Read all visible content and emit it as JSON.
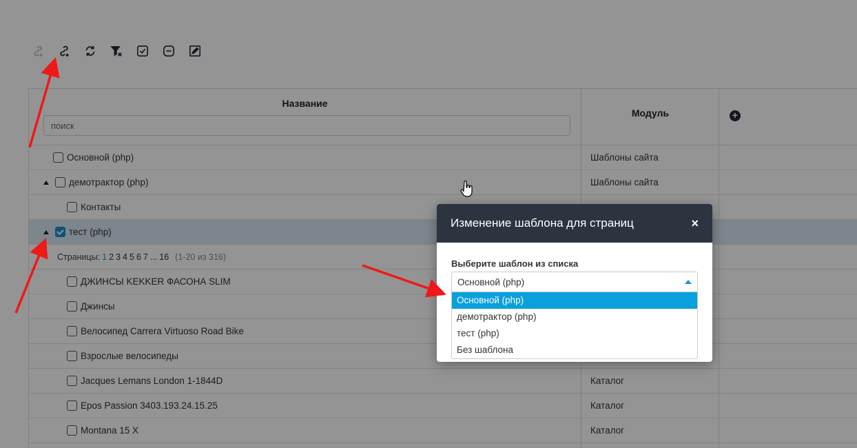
{
  "toolbar": {
    "icons": [
      "link-add-disabled-icon",
      "link-add-icon",
      "refresh-icon",
      "filter-clear-icon",
      "check-all-icon",
      "uncheck-all-icon",
      "edit-icon"
    ]
  },
  "table": {
    "col_title": "Название",
    "col_module": "Модуль",
    "search_placeholder": "поиск",
    "rows": [
      {
        "name": "Основной (php)",
        "module": "Шаблоны сайта"
      },
      {
        "name": "демотрактор (php)",
        "module": "Шаблоны сайта"
      },
      {
        "name": "Контакты",
        "module": ""
      },
      {
        "name": "тест (php)",
        "module": ""
      },
      {
        "name": "ДЖИНСЫ KEKKER ФАСОНА SLIM",
        "module": ""
      },
      {
        "name": "Джинсы",
        "module": ""
      },
      {
        "name": "Велосипед Carrera Virtuoso Road Bike",
        "module": ""
      },
      {
        "name": "Взрослые велосипеды",
        "module": ""
      },
      {
        "name": "Jacques Lemans London 1-1844D",
        "module": "Каталог"
      },
      {
        "name": "Epos Passion 3403.193.24.15.25",
        "module": "Каталог"
      },
      {
        "name": "Montana 15 X",
        "module": "Каталог"
      }
    ],
    "pager": {
      "label": "Страницы:",
      "pages": [
        "1",
        "2",
        "3",
        "4",
        "5",
        "6",
        "7",
        "...",
        "16"
      ],
      "count": "(1-20 из 316)"
    }
  },
  "modal": {
    "title": "Изменение шаблона для страниц",
    "close": "×",
    "label": "Выберите шаблон из списка",
    "selected": "Основной (php)",
    "options": [
      "Основной (php)",
      "демотрактор (php)",
      "тест (php)",
      "Без шаблона"
    ]
  },
  "colors": {
    "accent": "#1a8fd6",
    "modal_header": "#2c3440",
    "option_active": "#0aa0dd",
    "annotation_arrow": "#f01818"
  }
}
